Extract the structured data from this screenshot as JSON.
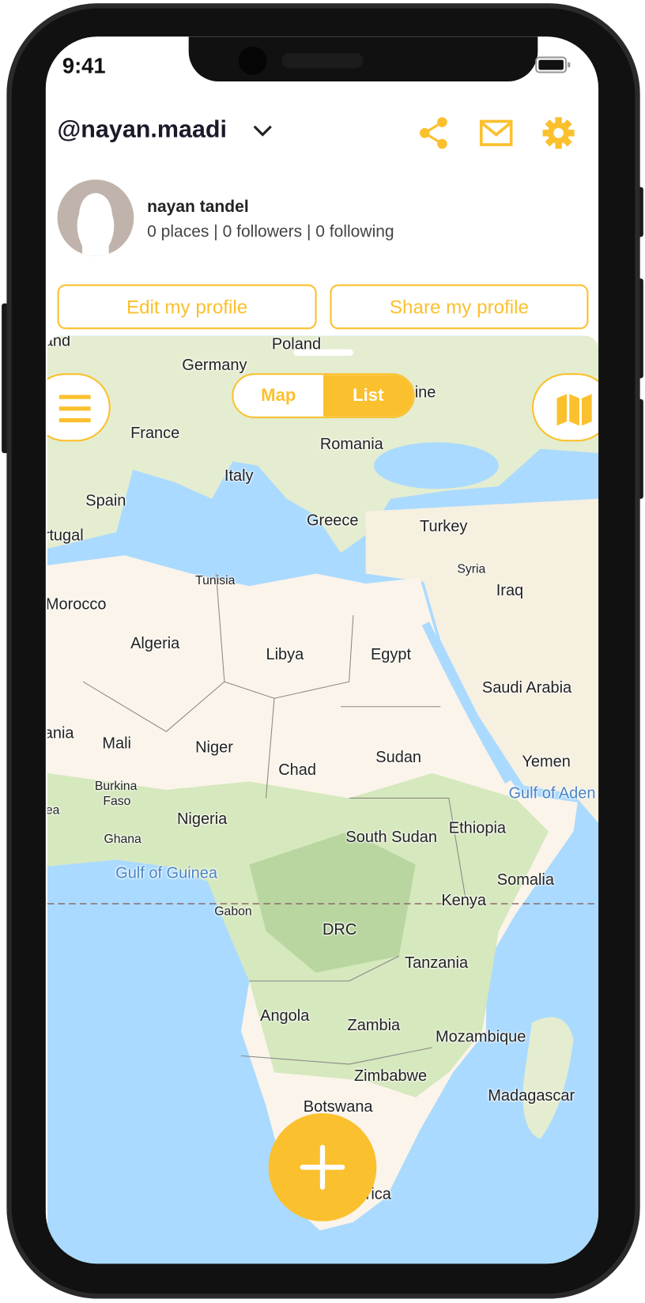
{
  "status_bar": {
    "time": "9:41"
  },
  "header": {
    "username": "@nayan.maadi",
    "icons": [
      "chevron-down-icon",
      "share-icon",
      "mail-icon",
      "gear-icon"
    ]
  },
  "profile": {
    "name": "nayan tandel",
    "stats": "0 places | 0 followers | 0 following"
  },
  "buttons": {
    "edit": "Edit my profile",
    "share": "Share my profile"
  },
  "map": {
    "toggle": {
      "map": "Map",
      "list": "List",
      "selected": "List"
    },
    "labels": [
      "and",
      "Poland",
      "Germany",
      "ine",
      "France",
      "Romania",
      "Italy",
      "Spain",
      "Greece",
      "Turkey",
      "rtugal",
      "Syria",
      "Tunisia",
      "Iraq",
      "Morocco",
      "Algeria",
      "Libya",
      "Egypt",
      "Saudi Arabia",
      "ania",
      "Mali",
      "Niger",
      "Chad",
      "Sudan",
      "Yemen",
      "Burkina",
      "Faso",
      "ea",
      "Gulf of Aden",
      "Nigeria",
      "Ethiopia",
      "Ghana",
      "South Sudan",
      "Gulf of Guinea",
      "Somalia",
      "Gabon",
      "Kenya",
      "DRC",
      "Tanzania",
      "Angola",
      "Zambia",
      "Mozambique",
      "Zimbabwe",
      "Madagascar",
      "Botswana",
      "rica"
    ]
  },
  "colors": {
    "accent": "#fbc02d",
    "sea": "#aadaff",
    "land": "#eef2dc",
    "desert": "#fdf5ec",
    "forest": "#c5dfb0"
  }
}
